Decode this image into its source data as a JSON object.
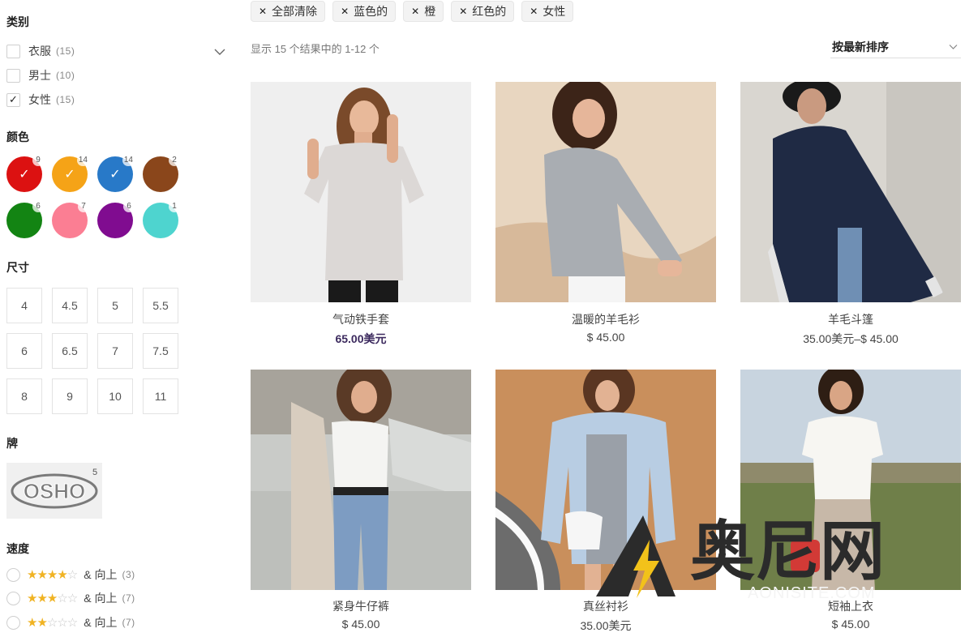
{
  "filters": {
    "category": {
      "title": "类别",
      "items": [
        {
          "label": "衣服",
          "count": "(15)",
          "checked": false
        },
        {
          "label": "男士",
          "count": "(10)",
          "checked": false
        },
        {
          "label": "女性",
          "count": "(15)",
          "checked": true
        }
      ]
    },
    "color": {
      "title": "颜色",
      "swatches": [
        {
          "name": "red",
          "hex": "#dc1111",
          "count": "9",
          "checked": true
        },
        {
          "name": "orange",
          "hex": "#f5a317",
          "count": "14",
          "checked": true
        },
        {
          "name": "blue",
          "hex": "#2879c8",
          "count": "14",
          "checked": true
        },
        {
          "name": "brown",
          "hex": "#8a461b",
          "count": "2",
          "checked": false
        },
        {
          "name": "green",
          "hex": "#138413",
          "count": "6",
          "checked": false
        },
        {
          "name": "pink",
          "hex": "#fb7e93",
          "count": "7",
          "checked": false
        },
        {
          "name": "purple",
          "hex": "#800c90",
          "count": "6",
          "checked": false
        },
        {
          "name": "teal",
          "hex": "#4ed4cf",
          "count": "1",
          "checked": false
        }
      ]
    },
    "size": {
      "title": "尺寸",
      "options": [
        "4",
        "4.5",
        "5",
        "5.5",
        "6",
        "6.5",
        "7",
        "7.5",
        "8",
        "9",
        "10",
        "11"
      ]
    },
    "brand": {
      "title": "牌",
      "logo_text": "OSHO",
      "count": "5"
    },
    "rating": {
      "title": "速度",
      "items": [
        {
          "stars": 4,
          "label": "& 向上",
          "count": "(3)"
        },
        {
          "stars": 3,
          "label": "& 向上",
          "count": "(7)"
        },
        {
          "stars": 2,
          "label": "& 向上",
          "count": "(7)"
        }
      ]
    }
  },
  "active_filters": [
    {
      "label": "全部清除"
    },
    {
      "label": "蓝色的"
    },
    {
      "label": "橙"
    },
    {
      "label": "红色的"
    },
    {
      "label": "女性"
    }
  ],
  "result_count": "显示 15 个结果中的 1-12 个",
  "sort": {
    "label": "按最新排序"
  },
  "products": [
    {
      "title": "气动铁手套",
      "price_parts": [
        {
          "t": "65.00美元",
          "acc": true
        }
      ]
    },
    {
      "title": "温暖的羊毛衫",
      "price_parts": [
        {
          "t": "$ 45.00",
          "acc": false
        }
      ]
    },
    {
      "title": "羊毛斗篷",
      "price_parts": [
        {
          "t": "35.00美元",
          "acc": false
        },
        {
          "t": "–",
          "acc": false
        },
        {
          "t": "$ 45.00",
          "acc": false
        }
      ]
    },
    {
      "title": "紧身牛仔裤",
      "price_parts": [
        {
          "t": "$ 45.00",
          "acc": false
        }
      ]
    },
    {
      "title": "真丝衬衫",
      "price_parts": [
        {
          "t": "35.00美元",
          "acc": false
        }
      ]
    },
    {
      "title": "短袖上衣",
      "price_parts": [
        {
          "t": "$ 45.00",
          "acc": false
        }
      ]
    }
  ],
  "watermark": {
    "text": "AONISITE.COM",
    "cn": "奥尼网"
  }
}
